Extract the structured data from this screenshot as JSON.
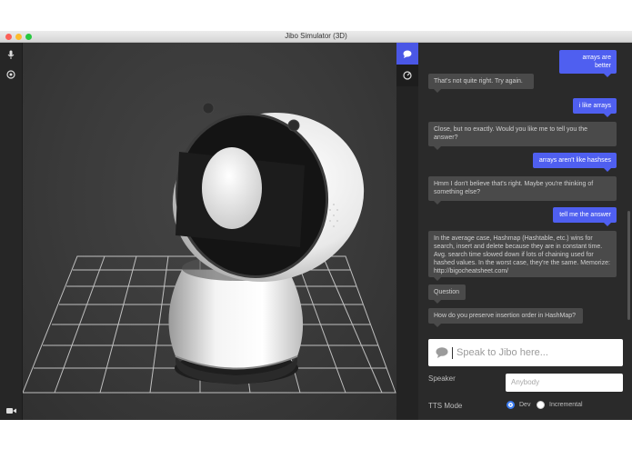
{
  "window": {
    "title": "Jibo Simulator (3D)"
  },
  "toolbar": {
    "icons": [
      "microphone-icon",
      "target-icon",
      "camera-icon"
    ]
  },
  "panel_tabs": [
    "chat-bubble-icon",
    "settings-icon"
  ],
  "messages": [
    {
      "from": "user",
      "text": "arrays are better"
    },
    {
      "from": "jibo",
      "text": "That's not quite right. Try again."
    },
    {
      "from": "user",
      "text": "i like arrays"
    },
    {
      "from": "jibo",
      "text": "Close, but no exactly. Would you like me to tell you the answer?"
    },
    {
      "from": "user",
      "text": "arrays aren't like hashses"
    },
    {
      "from": "jibo",
      "text": "Hmm I don't believe that's right. Maybe you're thinking of something else?"
    },
    {
      "from": "user",
      "text": "tell me the answer"
    },
    {
      "from": "jibo",
      "text": "In the average case, Hashmap (Hashtable, etc.) wins for search, insert and delete because they are in constant time. Avg. search time slowed down if lots of chaining used for hashed values. In the worst case, they're the same. Memorize: http://bigocheatsheet.com/"
    },
    {
      "from": "jibo",
      "text": "Question"
    },
    {
      "from": "jibo",
      "text": "How do you preserve insertion order in HashMap?"
    }
  ],
  "input": {
    "placeholder": "Speak to Jibo here..."
  },
  "speaker": {
    "label": "Speaker",
    "value": "Anybody"
  },
  "tts": {
    "label": "TTS Mode",
    "options": [
      "Dev",
      "Incremental"
    ],
    "selected": "Dev"
  },
  "colors": {
    "accent": "#4f5ff0",
    "bot_bubble": "#4a4a4a",
    "panel": "#2a2a2a"
  }
}
